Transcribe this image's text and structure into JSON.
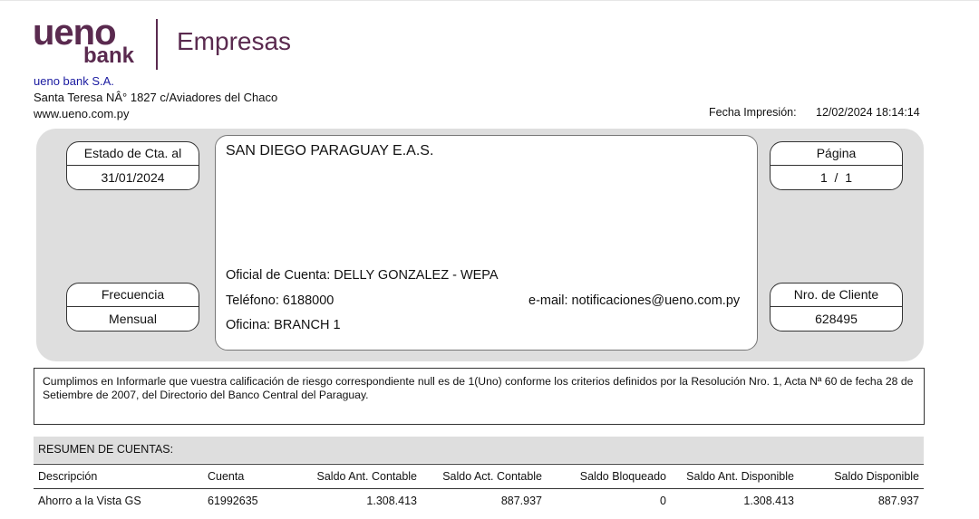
{
  "brand": {
    "logo_primary": "ueno",
    "logo_secondary": "bank",
    "logo_product": "Empresas",
    "color": "#5a2a4f"
  },
  "header": {
    "bank_name": "ueno bank S.A.",
    "address": "Santa Teresa NÂ° 1827 c/Aviadores del Chaco",
    "website": "www.ueno.com.py",
    "print_date_label": "Fecha Impresión:",
    "print_date_value": "12/02/2024 18:14:14"
  },
  "statement": {
    "estado_label": "Estado de Cta. al",
    "estado_value": "31/01/2024",
    "frecuencia_label": "Frecuencia",
    "frecuencia_value": "Mensual",
    "pagina_label": "Página",
    "pagina_value": "1  /  1",
    "cliente_label": "Nro. de Cliente",
    "cliente_value": "628495"
  },
  "client": {
    "name": "SAN DIEGO PARAGUAY E.A.S.",
    "oficial": "Oficial de Cuenta: DELLY GONZALEZ - WEPA",
    "telefono": "Teléfono: 6188000",
    "email": "e-mail: notificaciones@ueno.com.py",
    "oficina": "Oficina: BRANCH 1"
  },
  "notice": "Cumplimos en Informarle que vuestra calificación de riesgo correspondiente null es de 1(Uno) conforme los criterios definidos por la Resolución Nro. 1, Acta Nª 60 de fecha 28 de Setiembre de 2007, del Directorio del Banco Central del Paraguay.",
  "summary": {
    "title": "RESUMEN DE CUENTAS:",
    "columns": [
      "Descripción",
      "Cuenta",
      "Saldo Ant. Contable",
      "Saldo Act. Contable",
      "Saldo Bloqueado",
      "Saldo Ant. Disponible",
      "Saldo Disponible"
    ],
    "rows": [
      [
        "Ahorro a la Vista GS",
        "61992635",
        "1.308.413",
        "887.937",
        "0",
        "1.308.413",
        "887.937"
      ]
    ]
  }
}
